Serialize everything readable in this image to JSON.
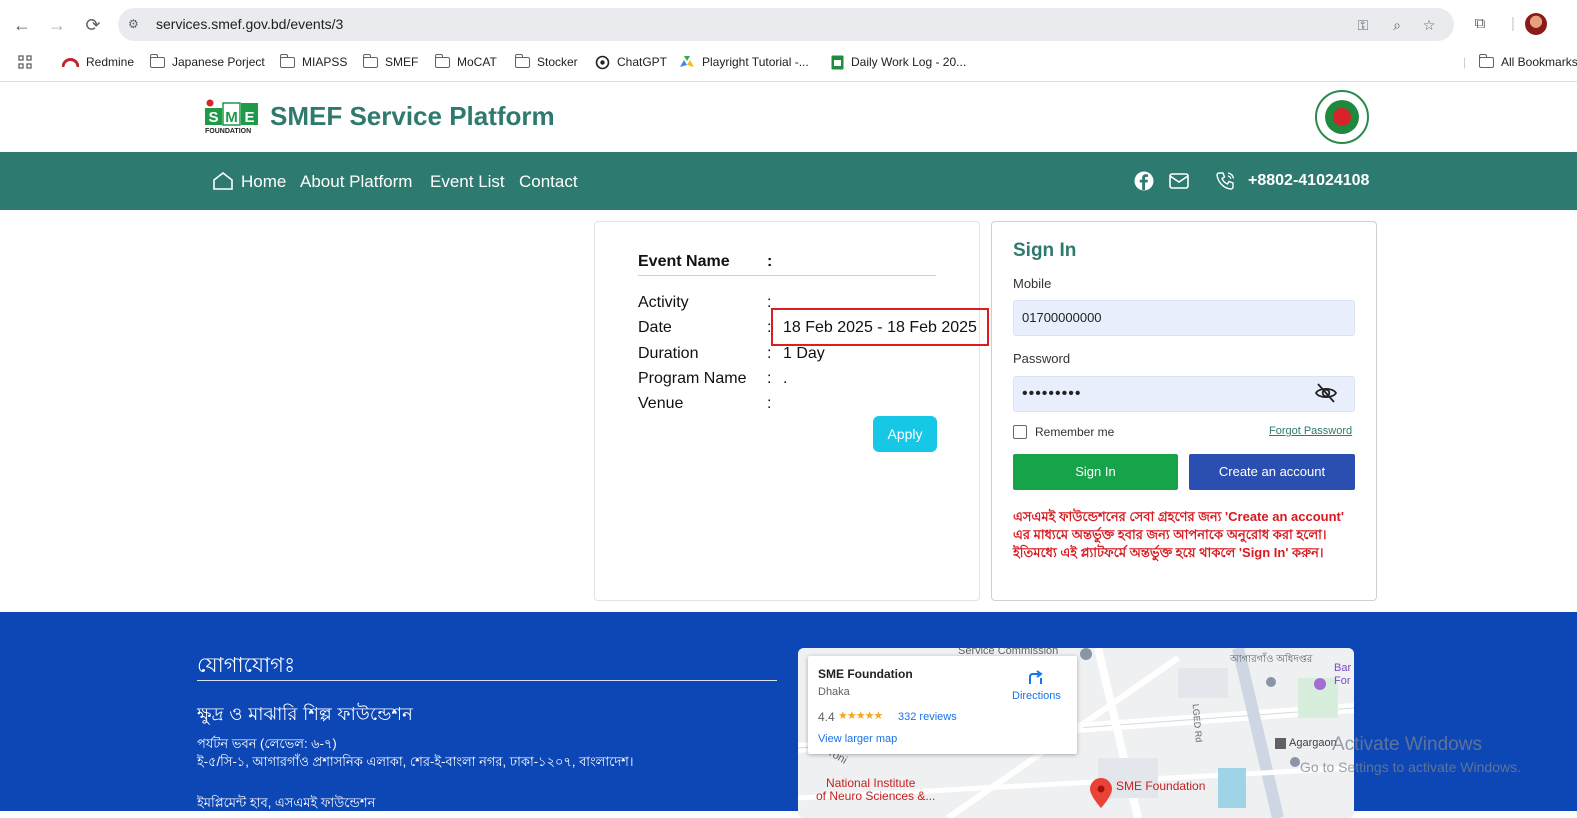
{
  "browser": {
    "url": "services.smef.gov.bd/events/3",
    "bookmarks": [
      {
        "label": "Redmine",
        "icon": "redmine-icon"
      },
      {
        "label": "Japanese Porject",
        "icon": "folder-icon"
      },
      {
        "label": "MIAPSS",
        "icon": "folder-icon"
      },
      {
        "label": "SMEF",
        "icon": "folder-icon"
      },
      {
        "label": "MoCAT",
        "icon": "folder-icon"
      },
      {
        "label": "Stocker",
        "icon": "folder-icon"
      },
      {
        "label": "ChatGPT",
        "icon": "chatgpt-icon"
      },
      {
        "label": "Playright Tutorial -...",
        "icon": "drive-icon"
      },
      {
        "label": "Daily Work Log - 20...",
        "icon": "sheets-icon"
      },
      {
        "label": "All Bookmarks",
        "icon": "folder-icon"
      }
    ]
  },
  "header": {
    "logo_text": "SME",
    "logo_sub": "FOUNDATION",
    "title": "SMEF Service Platform"
  },
  "nav": {
    "items": [
      "Home",
      "About Platform",
      "Event List",
      "Contact"
    ],
    "phone": "+8802-41024108"
  },
  "event": {
    "name_label": "Event Name",
    "name_value": "",
    "rows": [
      {
        "label": "Activity",
        "value": ""
      },
      {
        "label": "Date",
        "value": "18 Feb 2025 - 18 Feb 2025"
      },
      {
        "label": "Duration",
        "value": "1 Day"
      },
      {
        "label": "Program Name",
        "value": "."
      },
      {
        "label": "Venue",
        "value": ""
      }
    ],
    "separator": ":",
    "apply_label": "Apply"
  },
  "signin": {
    "title": "Sign In",
    "mobile_label": "Mobile",
    "mobile_value": "01700000000",
    "password_label": "Password",
    "password_value": "•••••••••",
    "remember_label": "Remember me",
    "forgot_label": "Forgot Password",
    "signin_button": "Sign In",
    "create_button": "Create an account",
    "notice": "এসএমই ফাউন্ডেশনের সেবা গ্রহণের জন্য 'Create an account' এর মাধ্যমে অন্তর্ভুক্ত হবার জন্য আপনাকে অনুরোধ করা হলো। ইতিমধ্যে এই প্ল্যাটফর্মে অন্তর্ভুক্ত হয়ে থাকলে 'Sign In' করুন।"
  },
  "footer": {
    "heading": "যোগাযোগঃ",
    "org_name": "ক্ষুদ্র ও মাঝারি শিল্প ফাউন্ডেশন",
    "address_line1": "পর্যটন ভবন (লেভেল: ৬-৭)",
    "address_line2": "ই-৫/সি-১, আগারগাঁও প্রশাসনিক এলাকা, শের-ই-বাংলা নগর, ঢাকা-১২০৭, বাংলাদেশ।",
    "address_line3": "ইমপ্লিমেন্ট হাব, এসএমই ফাউন্ডেশন"
  },
  "map": {
    "place": "SME Foundation",
    "city": "Dhaka",
    "rating": "4.4",
    "stars": "★★★★★",
    "reviews": "332 reviews",
    "larger_map": "View larger map",
    "directions": "Directions",
    "labels": {
      "service_commission": "Service Commission",
      "agargaon": "Agargaon",
      "national_institute": "National Institute",
      "neuro_sciences": "of Neuro Sciences &...",
      "sme_marker": "SME Foundation",
      "road_label": "Toroni",
      "bangla_text": "আগারগাঁও অধিদপ্তর",
      "bar_label": "Bar",
      "for_label": "For",
      "lged": "LGED Rd"
    }
  },
  "os_watermark": {
    "line1": "Activate Windows",
    "line2": "Go to Settings to activate Windows."
  },
  "colors": {
    "brand_teal": "#2c7a70",
    "footer_blue": "#0c47b5",
    "signin_green": "#17a34a",
    "create_blue": "#2a4fb0",
    "apply_cyan": "#17c7e6",
    "notice_red": "#d71920",
    "highlight_red": "#e01b1b"
  }
}
